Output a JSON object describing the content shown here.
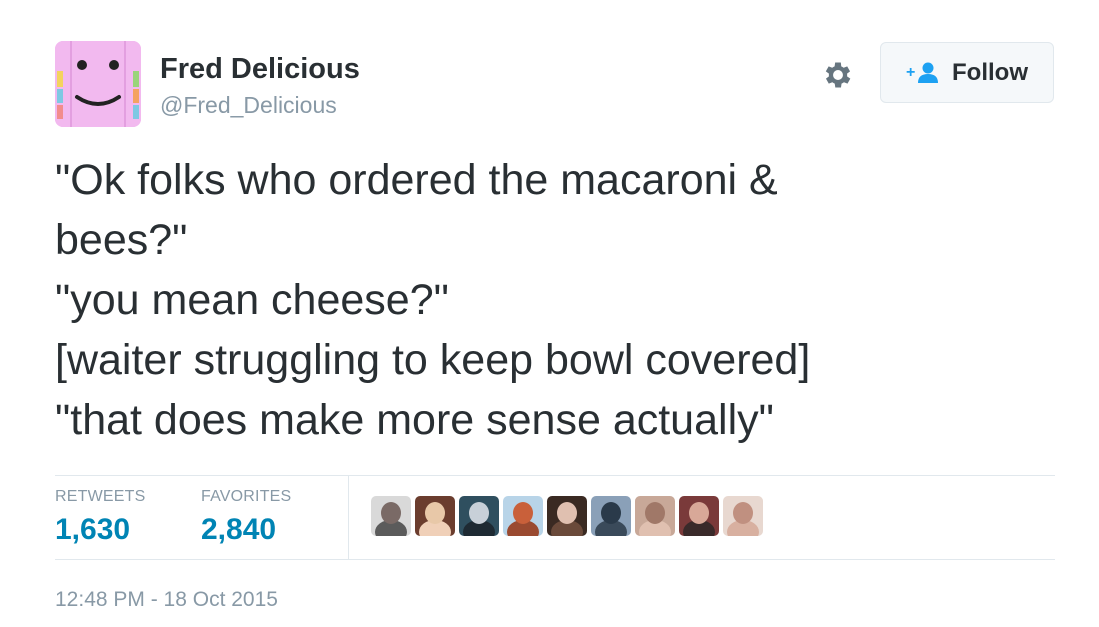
{
  "user": {
    "name": "Fred Delicious",
    "handle": "@Fred_Delicious",
    "avatar_icon": "smiley-face-avatar",
    "avatar_color": "#f2b9ef"
  },
  "actions": {
    "follow_label": "Follow",
    "follow_icon": "add-user-icon",
    "settings_icon": "gear-icon",
    "accent_color": "#1da1f2"
  },
  "tweet": {
    "lines": [
      "\"Ok folks who ordered the macaroni &",
      "bees?\"",
      "\"you mean cheese?\"",
      "[waiter struggling to keep bowl covered]",
      "\"that does make more sense actually\""
    ]
  },
  "stats": {
    "retweets_label": "RETWEETS",
    "retweets_count": "1,630",
    "favorites_label": "FAVORITES",
    "favorites_count": "2,840",
    "count_color": "#0084b4"
  },
  "favoriters": [
    {
      "bg": "#d9d9d9",
      "fg": "#7a6a66",
      "body": "#5b5b5b"
    },
    {
      "bg": "#6b3d2e",
      "fg": "#e8c8a8",
      "body": "#f0d0b8"
    },
    {
      "bg": "#2f4f5f",
      "fg": "#c8d0d8",
      "body": "#1e2a33"
    },
    {
      "bg": "#b8d4e8",
      "fg": "#c9603a",
      "body": "#9a4a30"
    },
    {
      "bg": "#3a2a22",
      "fg": "#e0c0b0",
      "body": "#6a4a3a"
    },
    {
      "bg": "#8aa0b8",
      "fg": "#2a3a4a",
      "body": "#3a4a5a"
    },
    {
      "bg": "#c8a898",
      "fg": "#a07868",
      "body": "#e0c0b0"
    },
    {
      "bg": "#7a3a3a",
      "fg": "#d8a898",
      "body": "#3a2a2a"
    },
    {
      "bg": "#e8d8d0",
      "fg": "#c09080",
      "body": "#d8b0a0"
    }
  ],
  "timestamp": "12:48 PM - 18 Oct 2015"
}
